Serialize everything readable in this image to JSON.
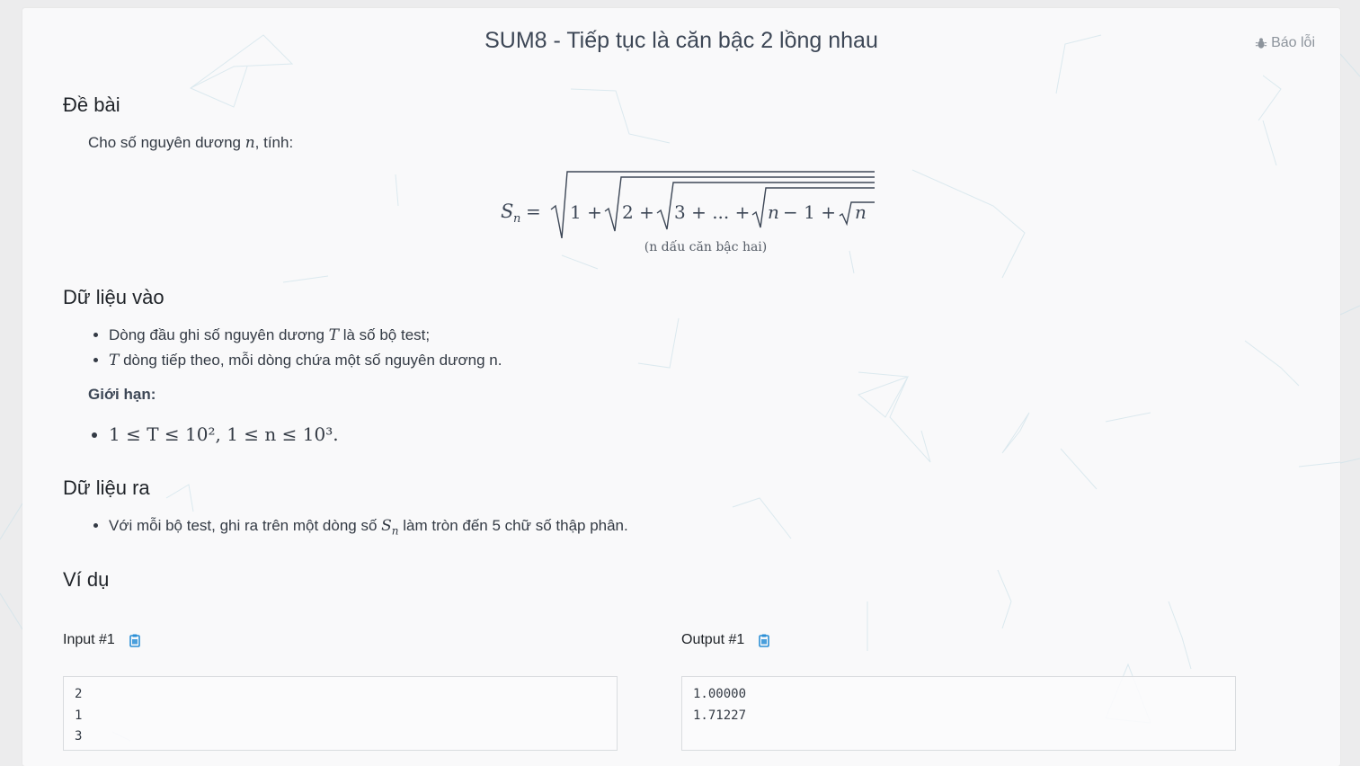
{
  "page": {
    "title": "SUM8 - Tiếp tục là căn bậc 2 lồng nhau",
    "report_label": "Báo lỗi"
  },
  "statement": {
    "heading": "Đề bài",
    "intro_before": "Cho số nguyên dương ",
    "intro_var": "n",
    "intro_after": ", tính:",
    "formula_lhs": "S",
    "formula_sub": "n",
    "formula_body": "1 + 2 + 3 + ... + n − 1 + n",
    "formula_note": "(n dấu căn bậc hai)"
  },
  "input": {
    "heading": "Dữ liệu vào",
    "items": [
      {
        "before": "Dòng đầu ghi số nguyên dương ",
        "var": "T",
        "after": " là số bộ test;"
      },
      {
        "before": "",
        "var": "T",
        "after": " dòng tiếp theo, mỗi dòng chứa một số nguyên dương n."
      }
    ],
    "limit_title": "Giới hạn:",
    "limit_text": "1 ≤ T ≤ 10², 1 ≤ n ≤ 10³."
  },
  "output": {
    "heading": "Dữ liệu ra",
    "item_before": "Với mỗi bộ test, ghi ra trên một dòng số ",
    "item_var": "S",
    "item_sub": "n",
    "item_after": " làm tròn đến 5 chữ số thập phân."
  },
  "example": {
    "heading": "Ví dụ",
    "input_label": "Input #1",
    "output_label": "Output #1",
    "input_text": "2\n1\n3",
    "output_text": "1.00000\n1.71227"
  },
  "colors": {
    "background": "#ececed",
    "card": "#fafafb",
    "accent_icon": "#2b8fd6"
  }
}
